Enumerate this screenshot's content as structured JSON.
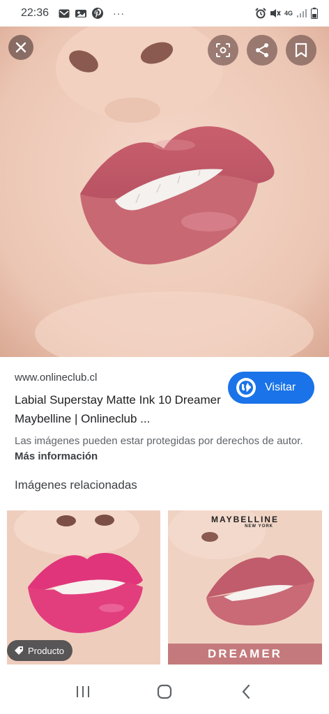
{
  "status_bar": {
    "time": "22:36",
    "network": "4G"
  },
  "hero": {
    "lip_color": "#c86873",
    "skin_color": "#ecc6b4"
  },
  "actions": {
    "close_icon": "close-icon",
    "lens_icon": "lens-icon",
    "share_icon": "share-icon",
    "save_icon": "bookmark-icon"
  },
  "result": {
    "source_domain": "www.onlineclub.cl",
    "title": "Labial Superstay Matte Ink 10 Dreamer Maybelline | Onlineclub ...",
    "visit_label": "Visitar",
    "copyright_text": "Las imágenes pueden estar protegidas por derechos de autor.",
    "more_info_label": "Más información"
  },
  "related": {
    "heading": "Imágenes relacionadas",
    "items": [
      {
        "badge_label": "Producto",
        "lip_color": "#e23e7e"
      },
      {
        "brand_logo": "MAYBELLINE",
        "brand_sub": "NEW YORK",
        "band_label": "DREAMER",
        "lip_color": "#c96a76"
      }
    ]
  },
  "colors": {
    "accent": "#1a73e8",
    "dreamer_band": "#c47a7c"
  }
}
